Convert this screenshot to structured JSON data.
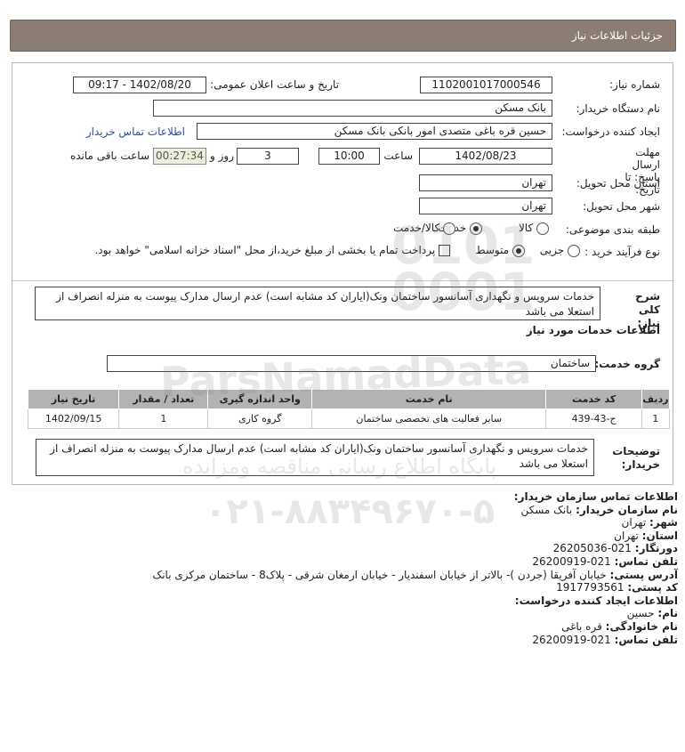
{
  "header": {
    "title": "جزئیات اطلاعات نیاز"
  },
  "form": {
    "need_number_label": "شماره نیاز:",
    "need_number": "1102001017000546",
    "announce_label": "تاریخ و ساعت اعلان عمومی:",
    "announce_value": "1402/08/20 - 09:17",
    "buyer_org_label": "نام دستگاه خریدار:",
    "buyer_org": "بانک مسکن",
    "creator_label": "ایجاد کننده درخواست:",
    "creator": "حسین  قره باغی متصدی امور بانکی بانک مسکن",
    "contact_link": "اطلاعات تماس خریدار",
    "deadline_label": "مهلت ارسال پاسخ: تا تاریخ:",
    "deadline_date": "1402/08/23",
    "hour_label": "ساعت",
    "deadline_time": "10:00",
    "days_value": "3",
    "days_label": "روز و",
    "remaining_time": "00:27:34",
    "remaining_label": "ساعت باقی مانده",
    "province_label": "استان محل تحویل:",
    "province": "تهران",
    "city_label": "شهر محل تحویل:",
    "city": "تهران",
    "category_label": "طبقه بندی موضوعی:",
    "category_options": [
      "کالا",
      "خدمت",
      "کالا/خدمت"
    ],
    "category_selected": "خدمت",
    "process_label": "نوع فرآیند خرید :",
    "process_options": [
      "جزیی",
      "متوسط"
    ],
    "process_selected": "متوسط",
    "payment_note": "پرداخت تمام یا بخشی از مبلغ خرید،از محل \"اسناد خزانه اسلامی\" خواهد بود."
  },
  "description": {
    "label": "شرح کلی نیاز:",
    "text": "خدمات سرویس و نگهداری آسانسور ساختمان ونک(ایاران کد مشابه است) عدم ارسال مدارک پیوست به منزله انصراف از استعلا می باشد"
  },
  "services": {
    "section_title": "اطلاعات خدمات مورد نیاز",
    "group_label": "گروه خدمت:",
    "group_value": "ساختمان",
    "columns": [
      "ردیف",
      "کد خدمت",
      "نام خدمت",
      "واحد اندازه گیری",
      "تعداد / مقدار",
      "تاریخ نیاز"
    ],
    "rows": [
      [
        "1",
        "ج-43-439",
        "سایر فعالیت های تخصصی ساختمان",
        "گروه کاری",
        "1",
        "1402/09/15"
      ]
    ]
  },
  "buyer_notes": {
    "label": "توضیحات خریدار:",
    "text": "خدمات سرویس و نگهداری آسانسور ساختمان ونک(ایاران کد مشابه است) عدم ارسال مدارک پیوست به منزله انصراف از استعلا می باشد"
  },
  "contact": {
    "title": "اطلاعات تماس سازمان خریدار:",
    "org_label": "نام سازمان خریدار:",
    "org": "بانک مسکن",
    "city_label": "شهر:",
    "city": "تهران",
    "province_label": "استان:",
    "province": "تهران",
    "fax_label": "دورنگار:",
    "fax": "021-26205036",
    "phone_label": "تلفن تماس:",
    "phone": "021-26200919",
    "address_label": "آدرس پستی:",
    "address": "خیابان آفریقا (جردن )- بالاتر از خیابان اسفندیار - خیابان ارمغان شرقی - پلاک8 - ساختمان مرکزی بانک",
    "postal_label": "کد پستی:",
    "postal": "1917793561",
    "creator_title": "اطلاعات ایجاد کننده درخواست:",
    "name_label": "نام:",
    "name": "حسین",
    "family_label": "نام خانوادگی:",
    "family": "قره باغی",
    "creator_phone_label": "تلفن تماس:",
    "creator_phone": "021-26200919"
  },
  "watermark": {
    "brand": "ParsNamadData",
    "site": "پایگاه اطلاع رسانی مناقصه ومزایده",
    "phone": "۰۲۱-۸۸۳۴۹۶۷۰-۵"
  }
}
